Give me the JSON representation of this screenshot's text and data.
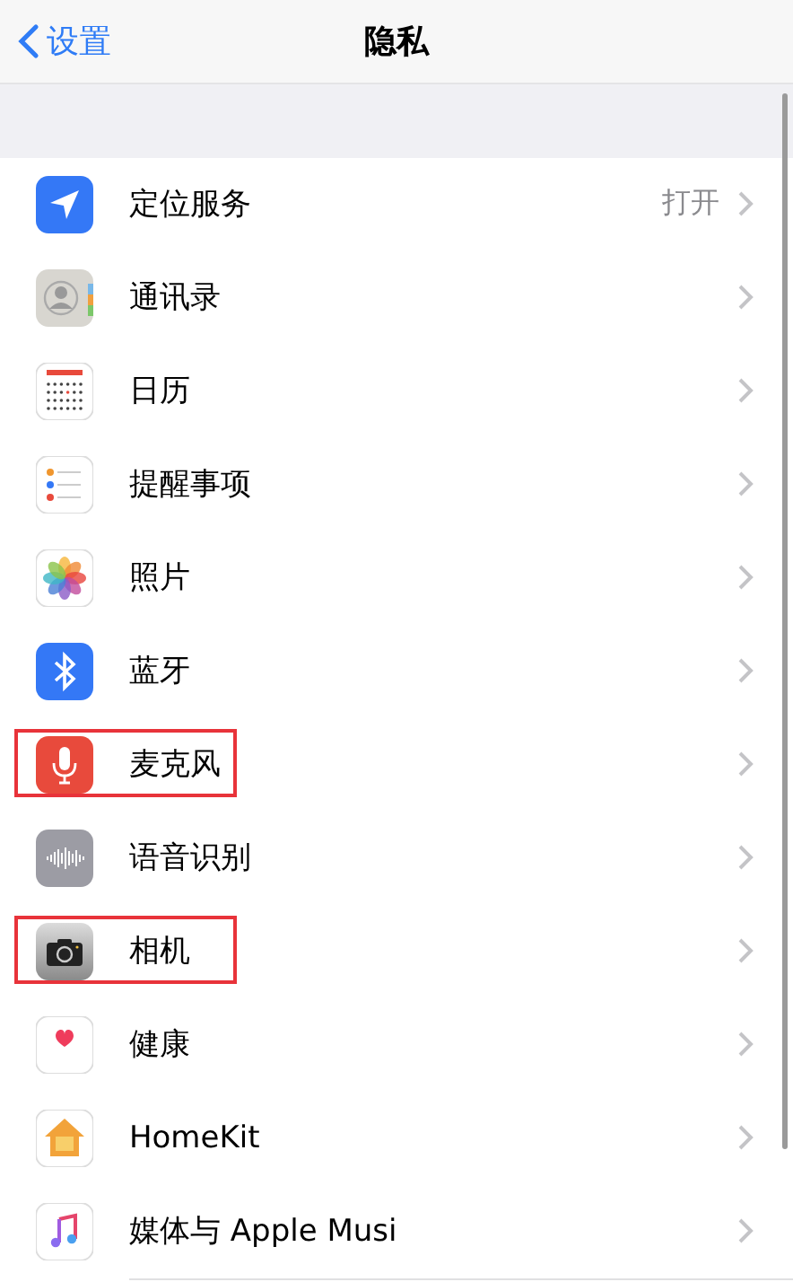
{
  "nav": {
    "back": "设置",
    "title": "隐私"
  },
  "rows": [
    {
      "kind": "location",
      "label": "定位服务",
      "value": "打开",
      "highlighted": false
    },
    {
      "kind": "contacts",
      "label": "通讯录",
      "highlighted": false
    },
    {
      "kind": "calendar",
      "label": "日历",
      "highlighted": false
    },
    {
      "kind": "reminders",
      "label": "提醒事项",
      "highlighted": false
    },
    {
      "kind": "photos",
      "label": "照片",
      "highlighted": false
    },
    {
      "kind": "bluetooth",
      "label": "蓝牙",
      "highlighted": false
    },
    {
      "kind": "microphone",
      "label": "麦克风",
      "highlighted": true
    },
    {
      "kind": "speech",
      "label": "语音识别",
      "highlighted": false
    },
    {
      "kind": "camera",
      "label": "相机",
      "highlighted": true
    },
    {
      "kind": "health",
      "label": "健康",
      "highlighted": false
    },
    {
      "kind": "home",
      "label": "HomeKit",
      "highlighted": false
    },
    {
      "kind": "music",
      "label": "媒体与 Apple Musi",
      "highlighted": false
    }
  ]
}
